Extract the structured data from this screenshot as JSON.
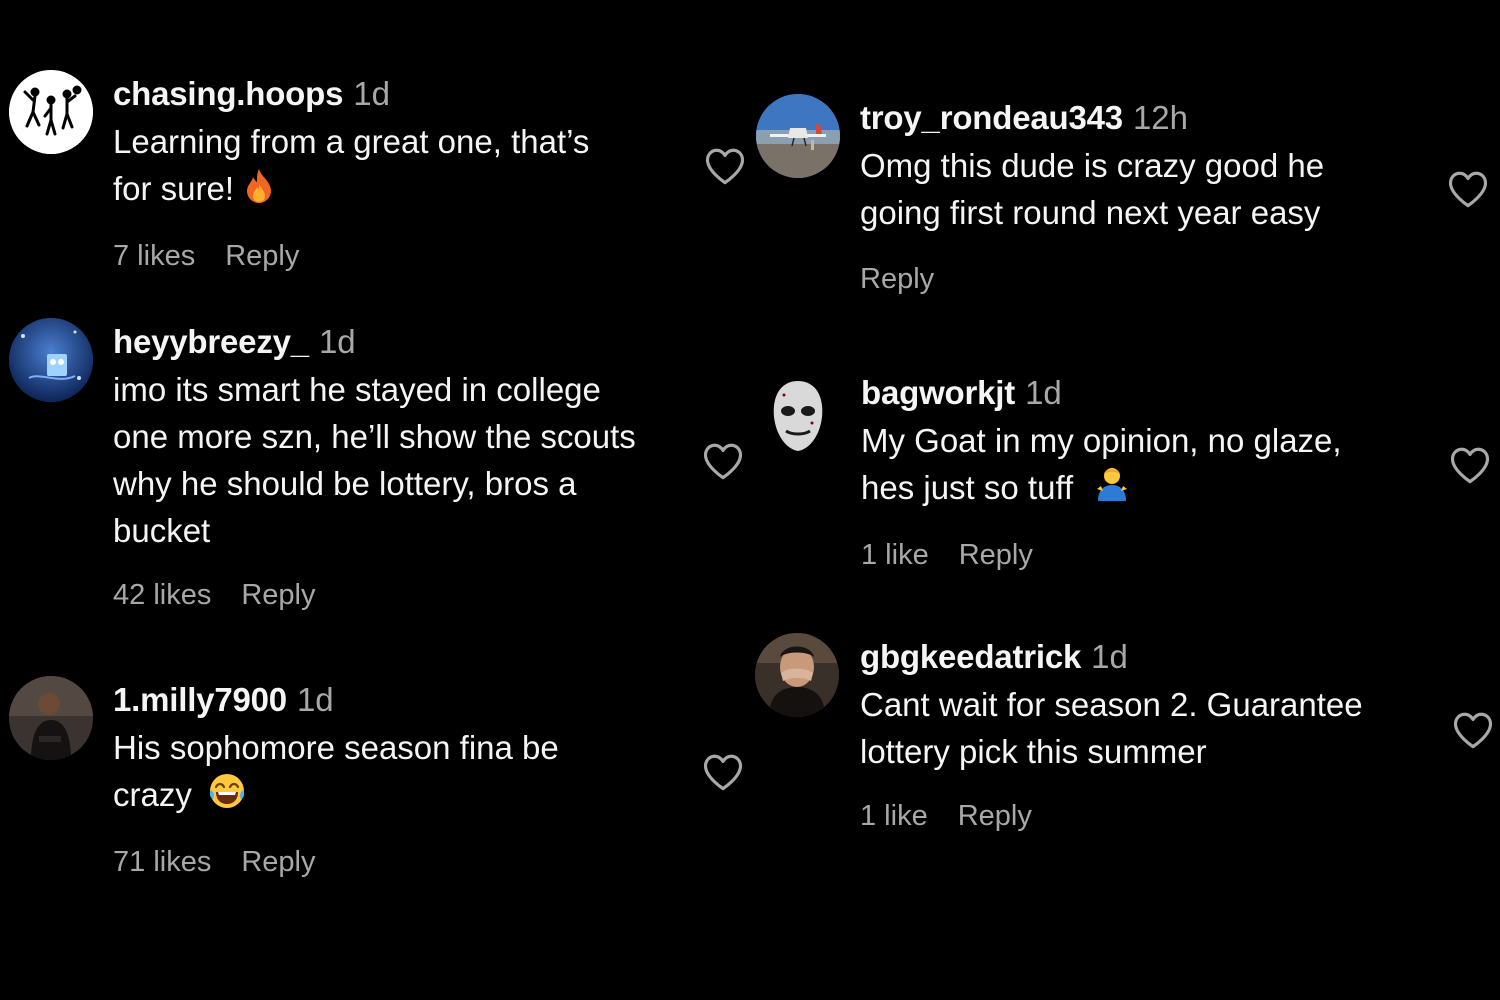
{
  "left_column": [
    {
      "username": "chasing.hoops",
      "time": "1d",
      "text_lines": [
        "Learning from a great one, that’s",
        "for sure!"
      ],
      "emoji": "fire-emoji",
      "likes": "7 likes",
      "reply": "Reply",
      "avatar": "basketball-players-avatar"
    },
    {
      "username": "heyybreezy_",
      "time": "1d",
      "text_lines": [
        "imo its smart he stayed in college",
        "one more szn, he’ll show the scouts",
        "why he should be lottery, bros a",
        "bucket"
      ],
      "likes": "42 likes",
      "reply": "Reply",
      "avatar": "spongebob-avatar"
    },
    {
      "username": "1.milly7900",
      "time": "1d",
      "text_lines": [
        "His sophomore season fina be",
        "crazy"
      ],
      "emoji": "laughing-emoji",
      "likes": "71 likes",
      "reply": "Reply",
      "avatar": "person-photo-avatar"
    }
  ],
  "right_column": [
    {
      "username": "troy_rondeau343",
      "time": "12h",
      "text_lines": [
        "Omg this dude is crazy good he",
        "going first round next year easy"
      ],
      "likes": "",
      "reply": "Reply",
      "avatar": "airplane-photo-avatar"
    },
    {
      "username": "bagworkjt",
      "time": "1d",
      "text_lines": [
        "My Goat in my opinion, no glaze,",
        "hes just so tuff"
      ],
      "emoji": "man-shrugging-emoji",
      "likes": "1 like",
      "reply": "Reply",
      "avatar": "mask-avatar"
    },
    {
      "username": "gbgkeedatrick",
      "time": "1d",
      "text_lines": [
        "Cant wait for season 2. Guarantee",
        "lottery pick this summer"
      ],
      "likes": "1 like",
      "reply": "Reply",
      "avatar": "person-covering-face-avatar"
    }
  ],
  "colors": {
    "background": "#000000",
    "text": "#f5f5f5",
    "secondary": "#a8a8a8",
    "heart_outline": "#a8a8a8"
  },
  "icons": {
    "like": "heart-outline-icon"
  }
}
